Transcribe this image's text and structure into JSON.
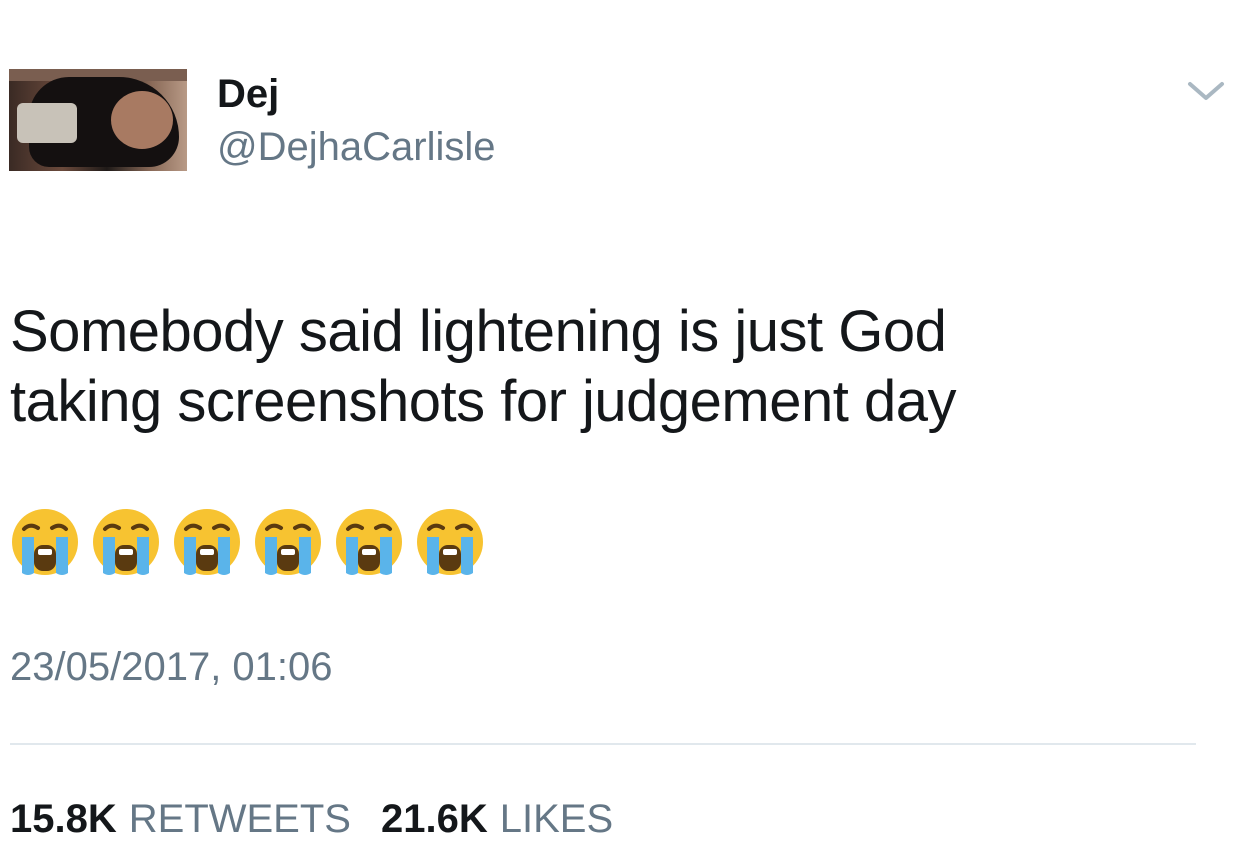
{
  "author": {
    "name": "Dej",
    "handle": "@DejhaCarlisle"
  },
  "tweet": {
    "text": "Somebody said lightening is just God\ntaking screenshots for judgement day",
    "emojis": [
      "loudly-crying-face-emoji",
      "loudly-crying-face-emoji",
      "loudly-crying-face-emoji",
      "loudly-crying-face-emoji",
      "loudly-crying-face-emoji",
      "loudly-crying-face-emoji"
    ],
    "timestamp": "23/05/2017, 01:06"
  },
  "stats": {
    "retweets_count": "15.8K",
    "retweets_label": "RETWEETS",
    "likes_count": "21.6K",
    "likes_label": "LIKES"
  },
  "icons": {
    "menu": "chevron-down-icon"
  },
  "colors": {
    "text": "#14171a",
    "secondary": "#657786",
    "divider": "#e1e8ed"
  }
}
